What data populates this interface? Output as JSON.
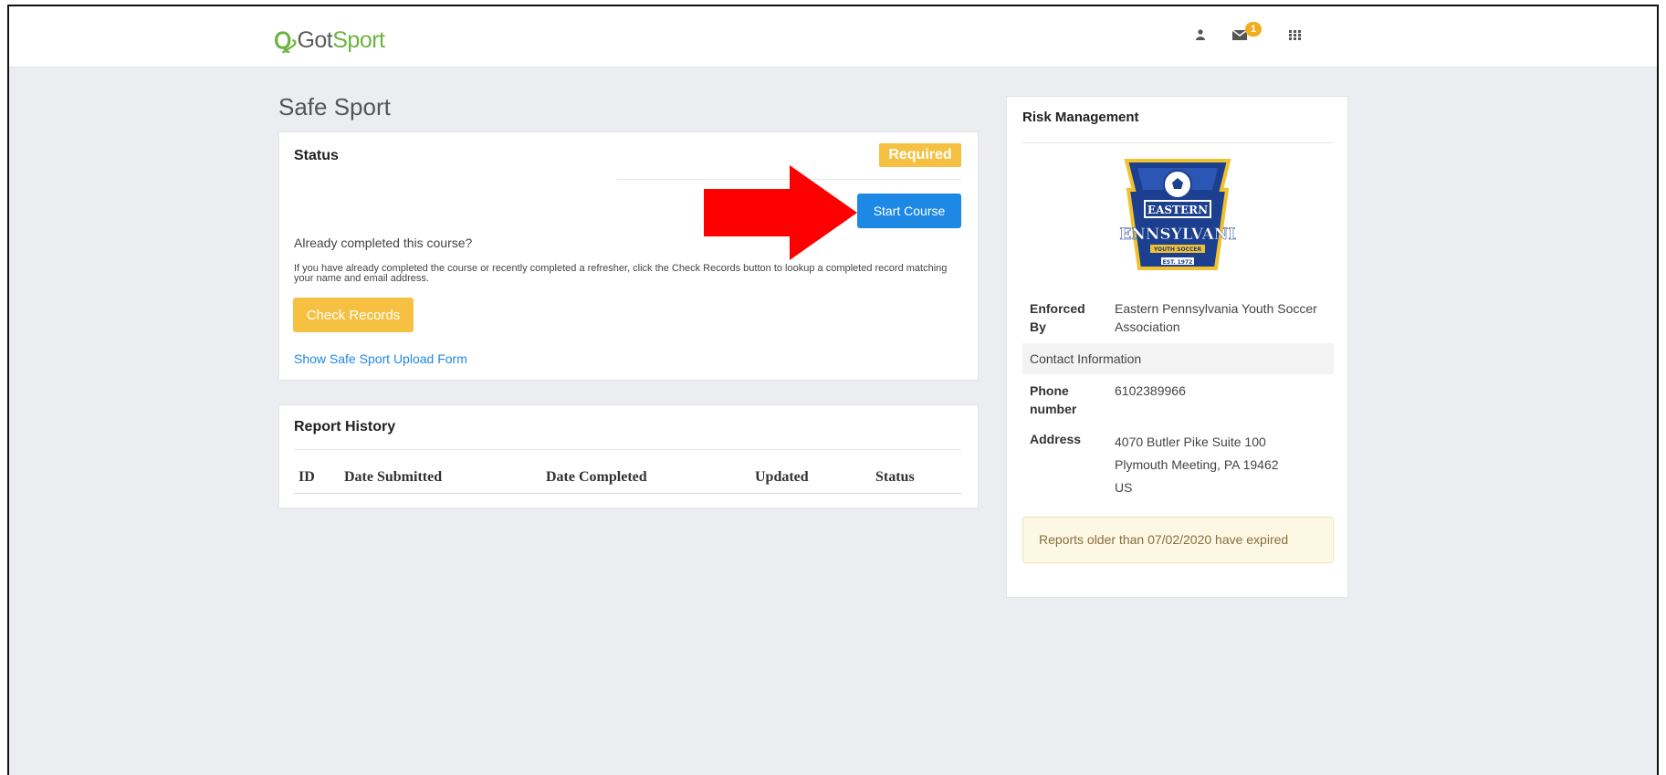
{
  "brand": {
    "mark": "Ꝙ",
    "name_a": "Got",
    "name_b": "Sport"
  },
  "nav": {
    "mail_count": "1"
  },
  "page": {
    "title": "Safe Sport"
  },
  "status_panel": {
    "heading": "Status",
    "badge": "Required",
    "start_button": "Start Course",
    "already_question": "Already completed this course?",
    "help_text": "If you have already completed the course or recently completed a refresher, click the Check Records button to lookup a completed record matching your name and email address.",
    "check_button": "Check Records",
    "upload_link": "Show Safe Sport Upload Form"
  },
  "report_history": {
    "heading": "Report History",
    "columns": [
      "ID",
      "Date Submitted",
      "Date Completed",
      "Updated",
      "Status"
    ]
  },
  "risk": {
    "title": "Risk Management",
    "crest_lines": [
      "EASTERN",
      "PENNSYLVANIA",
      "YOUTH SOCCER",
      "EST. 1972"
    ],
    "enforced_label": "Enforced By",
    "enforced_value": "Eastern Pennsylvania Youth Soccer Association",
    "contact_label": "Contact Information",
    "phone_label": "Phone number",
    "phone_value": "6102389966",
    "address_label": "Address",
    "address_line1": "4070 Butler Pike Suite 100",
    "address_line2": "Plymouth Meeting, PA 19462",
    "address_line3": "US",
    "expired_note": "Reports older than 07/02/2020 have expired"
  },
  "colors": {
    "brand_green": "#6cb33f",
    "primary_blue": "#1e88e5",
    "warning_yellow": "#f6c142",
    "annotation_red": "#ff0000",
    "crest_navy": "#1c3f8f",
    "crest_gold": "#f2c12e"
  },
  "icons": {
    "user": "user-icon",
    "mail": "envelope-icon",
    "apps": "grid-icon"
  }
}
